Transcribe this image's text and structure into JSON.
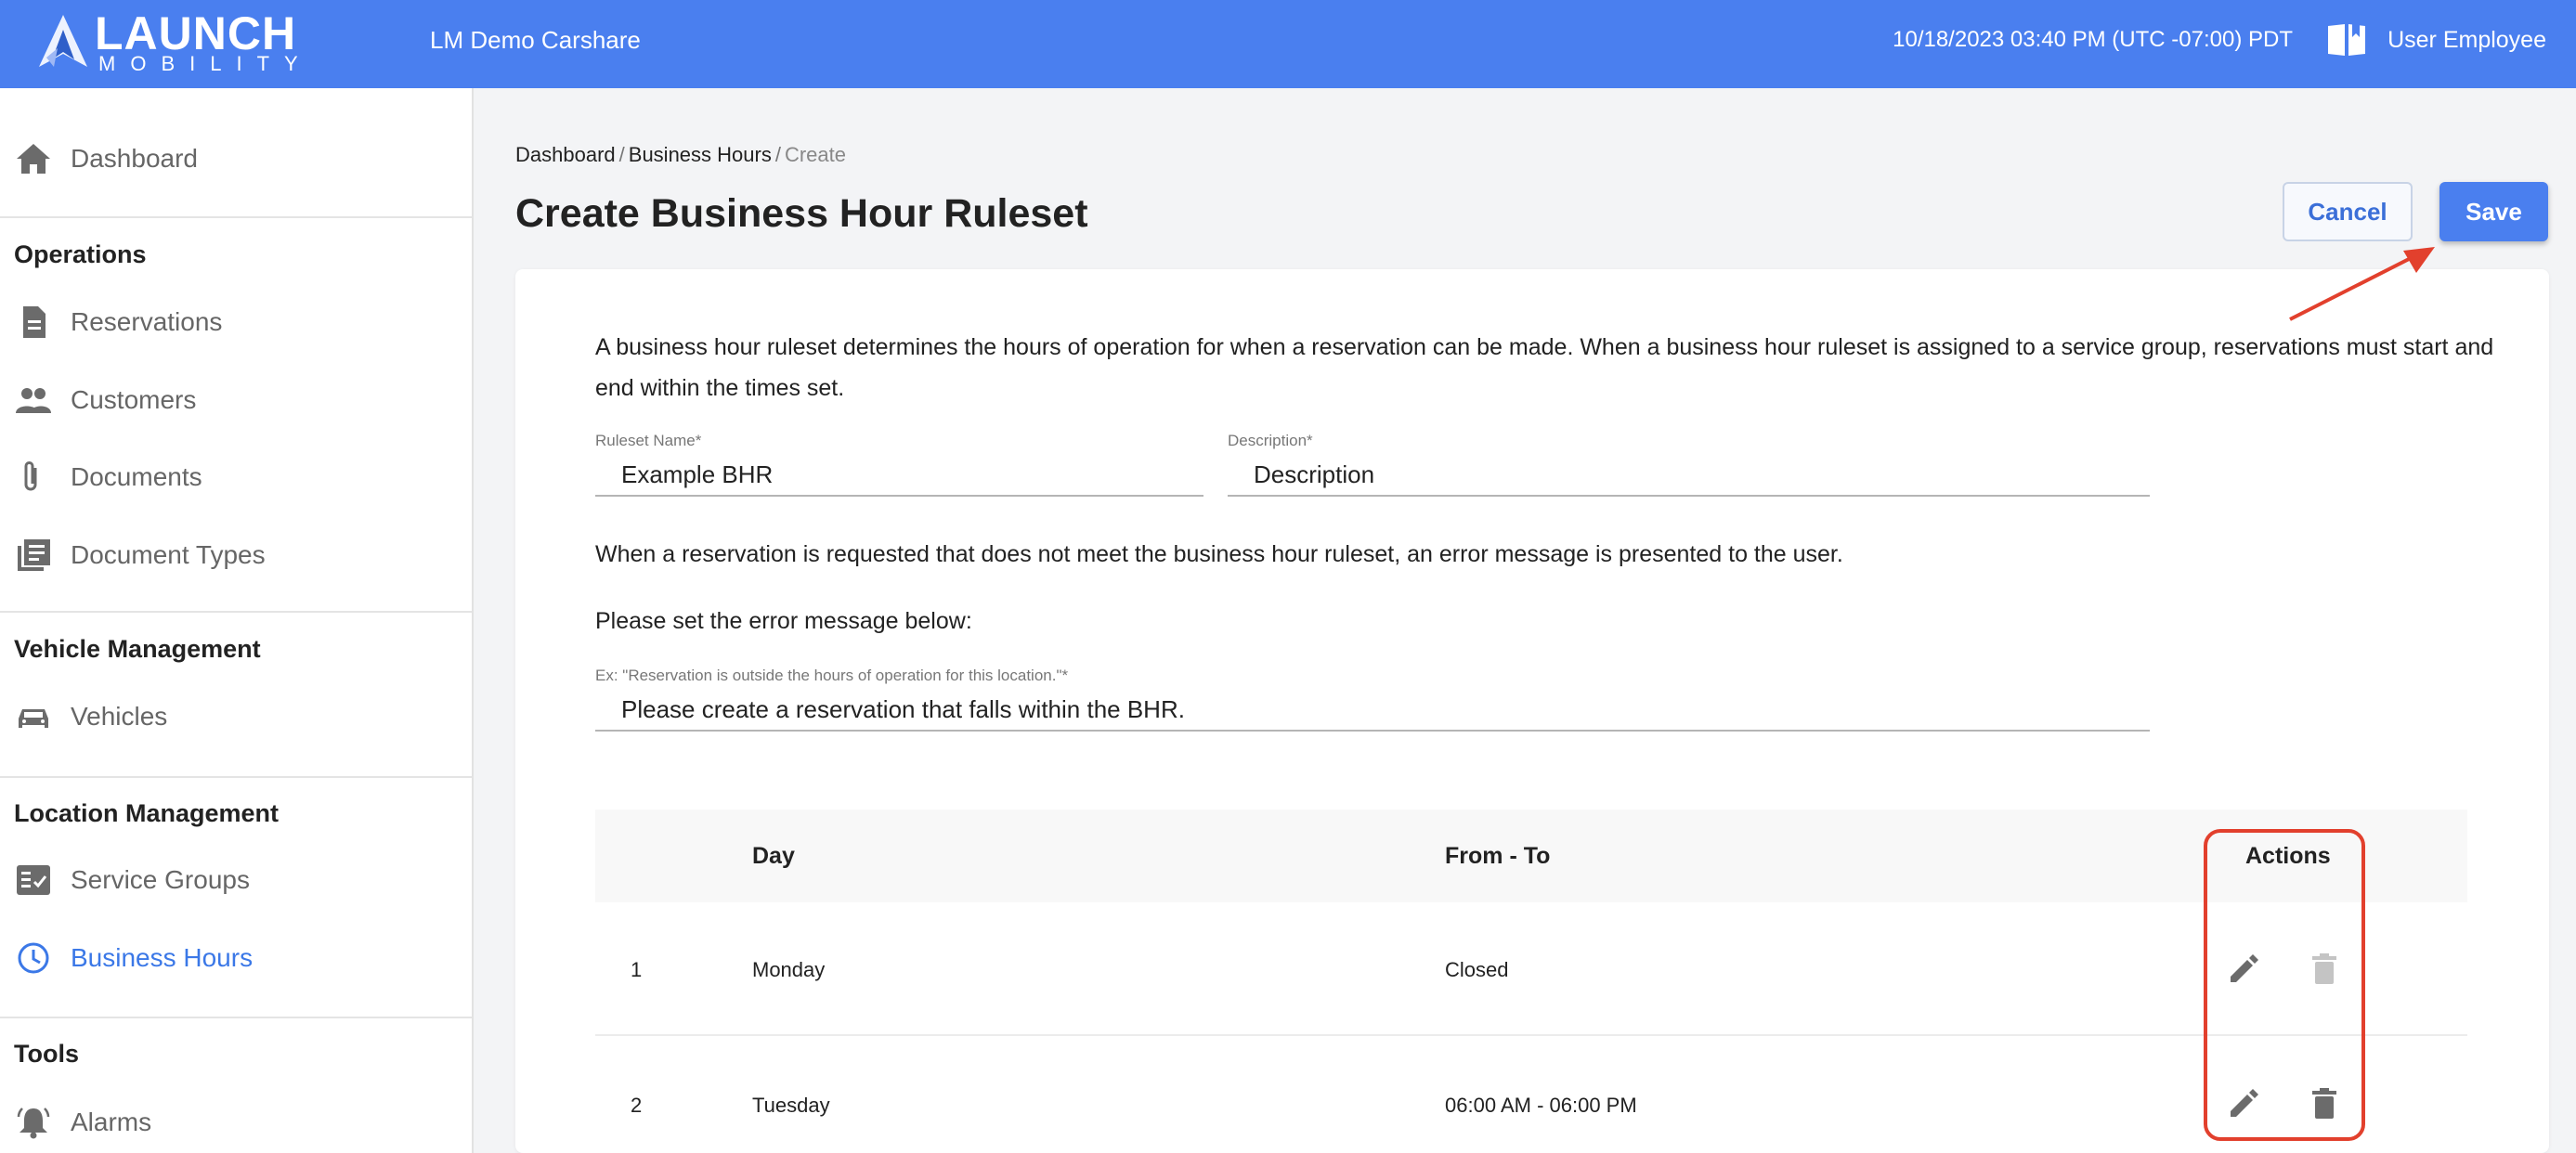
{
  "header": {
    "brand": "LAUNCH",
    "brand_sub": "MOBILITY",
    "app_title": "LM Demo Carshare",
    "datetime": "10/18/2023 03:40 PM (UTC -07:00) PDT",
    "help_icon": "book-icon",
    "user": "User Employee"
  },
  "sidebar": {
    "dashboard": "Dashboard",
    "sections": [
      {
        "title": "Operations",
        "items": [
          {
            "label": "Reservations",
            "icon": "document-icon"
          },
          {
            "label": "Customers",
            "icon": "people-icon"
          },
          {
            "label": "Documents",
            "icon": "paperclip-icon"
          },
          {
            "label": "Document Types",
            "icon": "library-icon"
          }
        ]
      },
      {
        "title": "Vehicle Management",
        "items": [
          {
            "label": "Vehicles",
            "icon": "car-icon"
          }
        ]
      },
      {
        "title": "Location Management",
        "items": [
          {
            "label": "Service Groups",
            "icon": "checklist-icon"
          },
          {
            "label": "Business Hours",
            "icon": "clock-icon",
            "active": true
          }
        ]
      },
      {
        "title": "Tools",
        "items": [
          {
            "label": "Alarms",
            "icon": "bell-icon"
          }
        ]
      }
    ]
  },
  "breadcrumb": {
    "items": [
      "Dashboard",
      "Business Hours"
    ],
    "separator": "/",
    "current": "Create"
  },
  "page": {
    "title": "Create Business Hour Ruleset",
    "cancel": "Cancel",
    "save": "Save"
  },
  "form": {
    "intro": "A business hour ruleset determines the hours of operation for when a reservation can be made. When a business hour ruleset is assigned to a service group, reservations must start and end within the times set.",
    "ruleset_name_label": "Ruleset Name*",
    "ruleset_name_value": "Example BHR",
    "description_label": "Description*",
    "description_value": "Description",
    "error_note": "When a reservation is requested that does not meet the business hour ruleset, an error message is presented to the user.",
    "error_prompt": "Please set the error message below:",
    "error_label": "Ex: \"Reservation is outside the hours of operation for this location.\"*",
    "error_value": "Please create a reservation that falls within the BHR."
  },
  "table": {
    "headers": {
      "day": "Day",
      "from_to": "From - To",
      "actions": "Actions"
    },
    "rows": [
      {
        "num": "1",
        "day": "Monday",
        "hours": "Closed",
        "delete_enabled": false
      },
      {
        "num": "2",
        "day": "Tuesday",
        "hours": "06:00 AM - 06:00 PM",
        "delete_enabled": true
      }
    ]
  },
  "colors": {
    "primary": "#4a7fef",
    "active_nav": "#3b78e7",
    "annotation": "#e2402d"
  }
}
